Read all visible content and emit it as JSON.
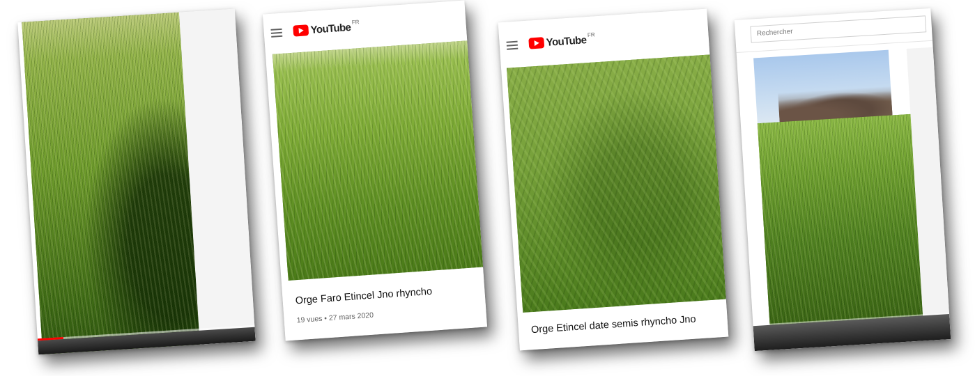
{
  "cards": [
    {
      "id": "card-1",
      "progress_fraction": 0.12
    },
    {
      "id": "card-2",
      "brand": "YouTube",
      "region": "FR",
      "video_title": "Orge Faro Etincel Jno rhyncho",
      "video_meta": "19 vues • 27 mars 2020"
    },
    {
      "id": "card-3",
      "brand": "YouTube",
      "region": "FR",
      "video_title": "Orge Etincel date semis rhyncho Jno"
    },
    {
      "id": "card-4",
      "search_placeholder": "Rechercher"
    }
  ],
  "colors": {
    "youtube_red": "#ff0000",
    "grass_green": "#5d8a24",
    "meta_gray": "#606060"
  },
  "icons": {
    "menu": "hamburger-menu-icon",
    "logo": "youtube-play-icon"
  }
}
